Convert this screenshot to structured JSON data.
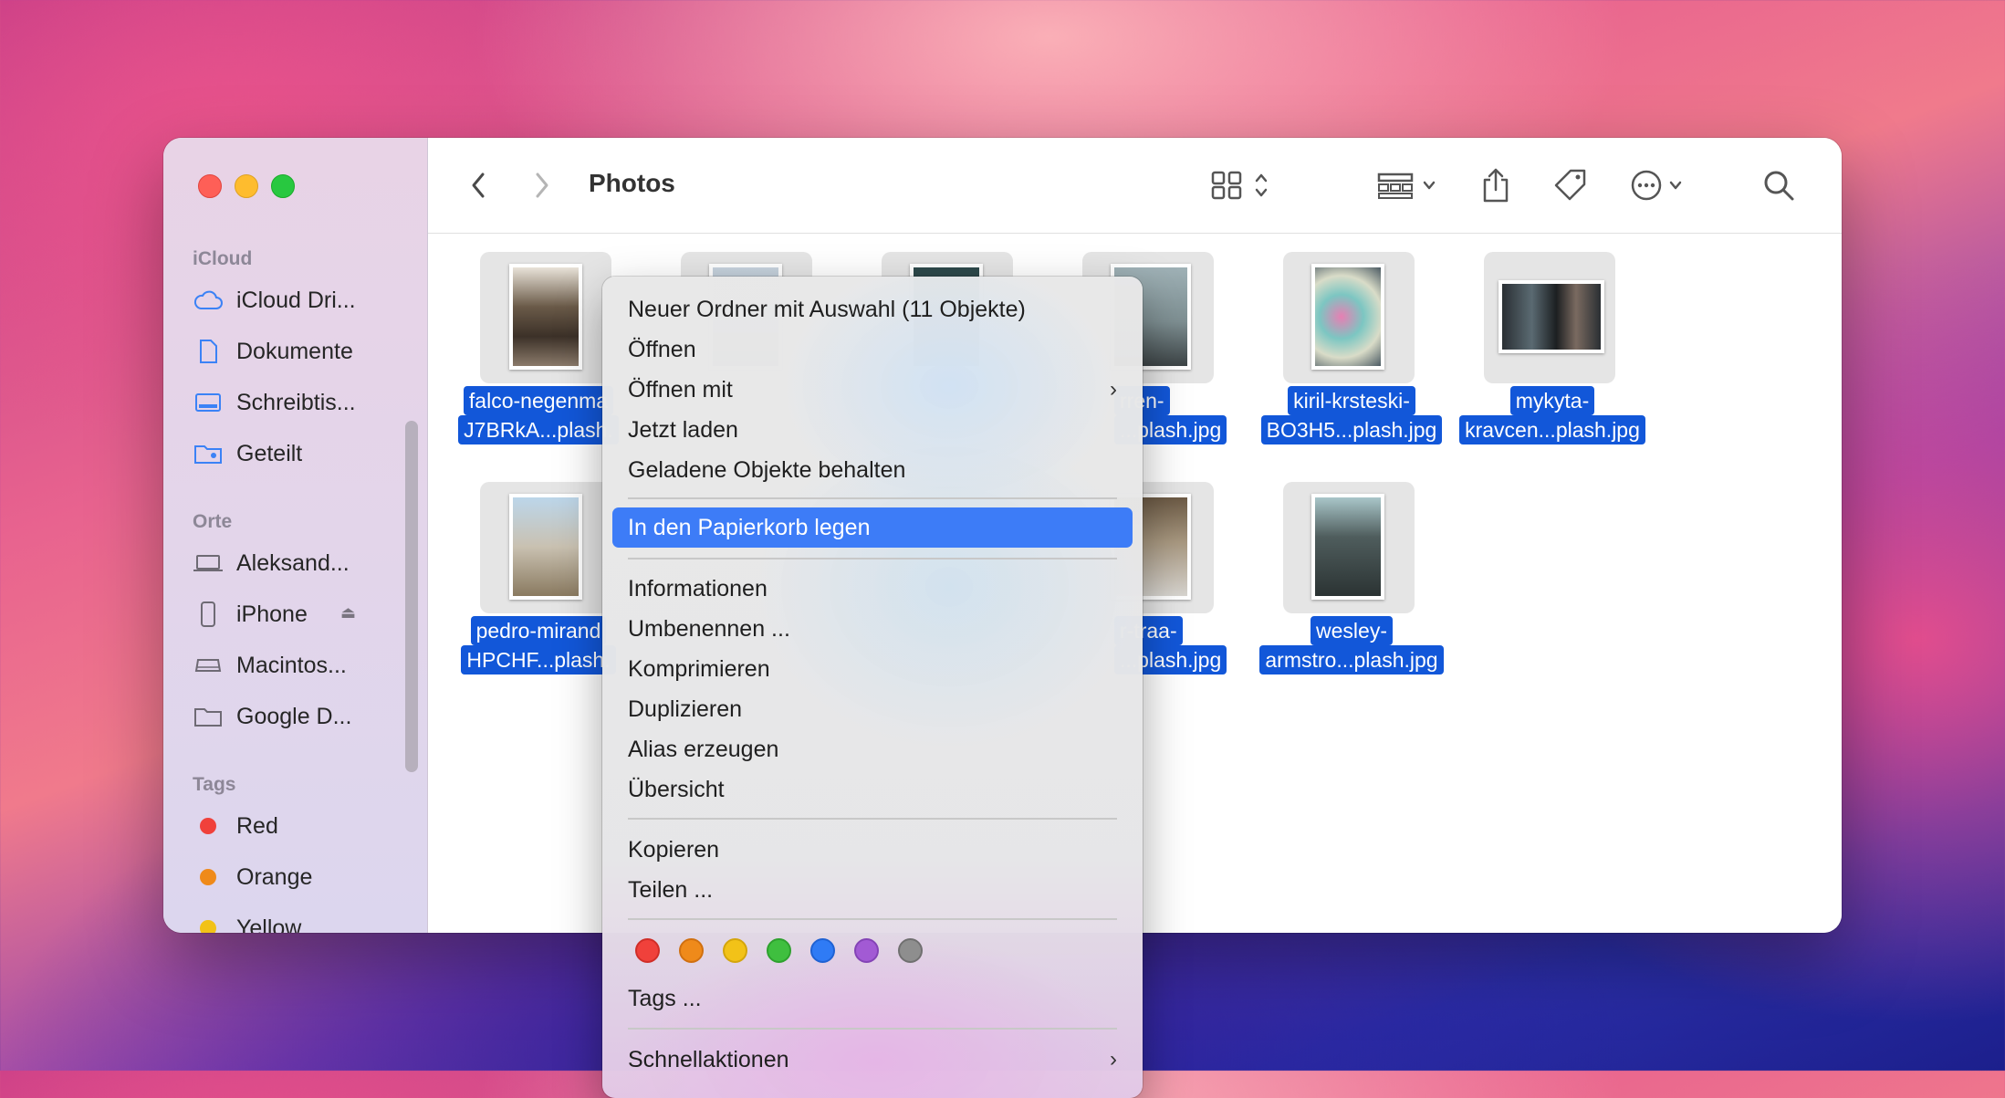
{
  "window": {
    "title": "Photos"
  },
  "sidebar": {
    "sections": {
      "icloud": "iCloud",
      "orte": "Orte",
      "tags": "Tags"
    },
    "icloud_items": [
      "iCloud Dri...",
      "Dokumente",
      "Schreibtis...",
      "Geteilt"
    ],
    "orte_items": [
      "Aleksand...",
      "iPhone",
      "Macintos...",
      "Google D..."
    ],
    "tag_items": [
      {
        "label": "Red",
        "color": "#f0413b"
      },
      {
        "label": "Orange",
        "color": "#ef8a1a"
      },
      {
        "label": "Yellow",
        "color": "#f2c218"
      }
    ]
  },
  "toolbar": {
    "icons": [
      "chevron-left-icon",
      "chevron-right-icon",
      "grid-view-icon",
      "group-icon",
      "share-icon",
      "tag-icon",
      "more-icon",
      "search-icon"
    ]
  },
  "files": [
    {
      "line1": "falco-negenma",
      "line2": "J7BRkA...plash."
    },
    {
      "line1": "rren-",
      "line2": "...plash.jpg"
    },
    {
      "line1": "kiril-krsteski-",
      "line2": "BO3H5...plash.jpg"
    },
    {
      "line1": "mykyta-",
      "line2": "kravcen...plash.jpg"
    },
    {
      "line1": "pedro-mirand",
      "line2": "HPCHF...plash."
    },
    {
      "line1": "r-traa-",
      "line2": "...plash.jpg"
    },
    {
      "line1": "wesley-",
      "line2": "armstro...plash.jpg"
    }
  ],
  "menu": {
    "items": [
      "Neuer Ordner mit Auswahl (11 Objekte)",
      "Öffnen",
      "Öffnen mit",
      "Jetzt laden",
      "Geladene Objekte behalten",
      "In den Papierkorb legen",
      "Informationen",
      "Umbenennen ...",
      "Komprimieren",
      "Duplizieren",
      "Alias erzeugen",
      "Übersicht",
      "Kopieren",
      "Teilen ...",
      "Tags ...",
      "Schnellaktionen"
    ],
    "tag_colors": [
      "#f0413b",
      "#ef8a1a",
      "#f2c218",
      "#3fbf3f",
      "#2f7bf5",
      "#a25ad4",
      "#8e8e8e"
    ],
    "submenu_arrow": "›"
  }
}
